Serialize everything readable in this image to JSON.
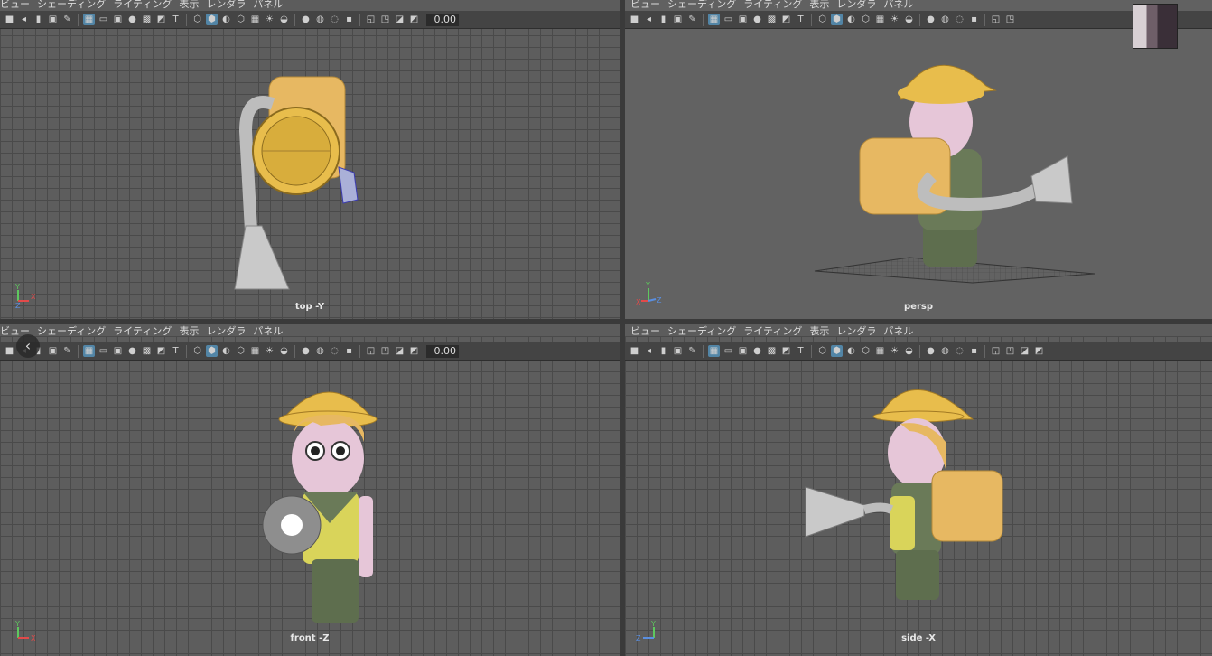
{
  "menu": [
    "ビュー",
    "シェーディング",
    "ライティング",
    "表示",
    "レンダラ",
    "パネル"
  ],
  "field_value": "0.00",
  "panels": {
    "top": {
      "camera": "top -Y"
    },
    "persp": {
      "camera": "persp"
    },
    "front": {
      "camera": "front -Z"
    },
    "side": {
      "camera": "side -X"
    }
  },
  "axes": {
    "top": [
      "Y",
      "X",
      "Z"
    ],
    "persp": [
      "Y",
      "X",
      "Z"
    ],
    "front": [
      "Y",
      "X"
    ],
    "side": [
      "Y",
      "Z"
    ]
  },
  "colors": {
    "helmet": "#e8bd4c",
    "backpack": "#e7b862",
    "skin": "#e6c6d8",
    "shirt": "#d9d45a",
    "pants": "#5e6e4e",
    "metal": "#c9c9c9",
    "accent": "#5285a6"
  }
}
